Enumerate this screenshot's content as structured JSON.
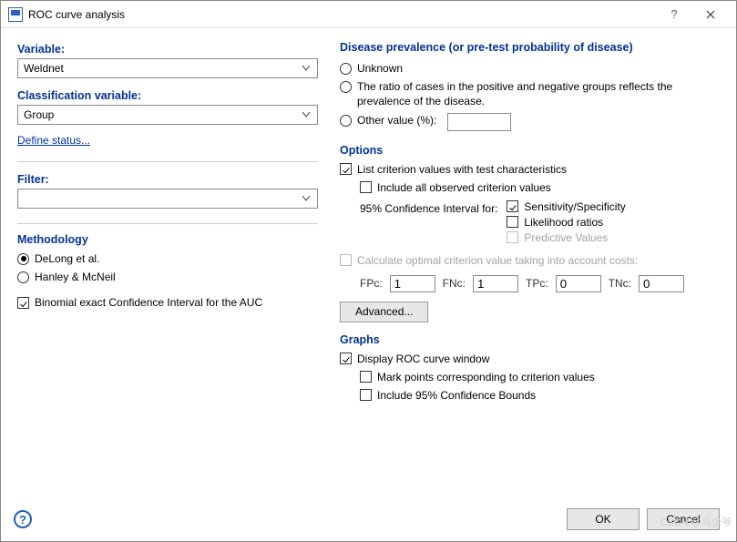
{
  "window": {
    "title": "ROC curve analysis",
    "help_text": "?",
    "close_icon": "close-icon"
  },
  "left": {
    "variable_label": "Variable:",
    "variable_value": "Weldnet",
    "class_var_label": "Classification variable:",
    "class_var_value": "Group",
    "define_status_link": "Define status...",
    "filter_label": "Filter:",
    "filter_value": "",
    "methodology_label": "Methodology",
    "method_delong": "DeLong et al.",
    "method_hanley": "Hanley & McNeil",
    "binomial_ci_label": "Binomial exact Confidence Interval for the AUC"
  },
  "prevalence": {
    "heading": "Disease prevalence (or pre-test probability of disease)",
    "unknown": "Unknown",
    "ratio": "The ratio of cases in the positive and negative groups reflects the prevalence of the disease.",
    "other_value": "Other value (%):",
    "other_value_val": ""
  },
  "options": {
    "heading": "Options",
    "list_criterion": "List criterion values with test characteristics",
    "include_all": "Include all observed criterion values",
    "ci_label": "95% Confidence Interval for:",
    "ci_sens_spec": "Sensitivity/Specificity",
    "ci_lr": "Likelihood ratios",
    "ci_pv": "Predictive Values",
    "calc_optimal": "Calculate optimal criterion value taking into account costs:",
    "fpc_label": "FPc:",
    "fpc_val": "1",
    "fnc_label": "FNc:",
    "fnc_val": "1",
    "tpc_label": "TPc:",
    "tpc_val": "0",
    "tnc_label": "TNc:",
    "tnc_val": "0",
    "advanced_btn": "Advanced..."
  },
  "graphs": {
    "heading": "Graphs",
    "display_roc": "Display ROC curve window",
    "mark_points": "Mark points corresponding to criterion values",
    "include_cb": "Include 95% Confidence Bounds"
  },
  "footer": {
    "help_icon_text": "?",
    "ok": "OK",
    "cancel": "Cancel"
  },
  "watermark": "CSDN @马少爷"
}
